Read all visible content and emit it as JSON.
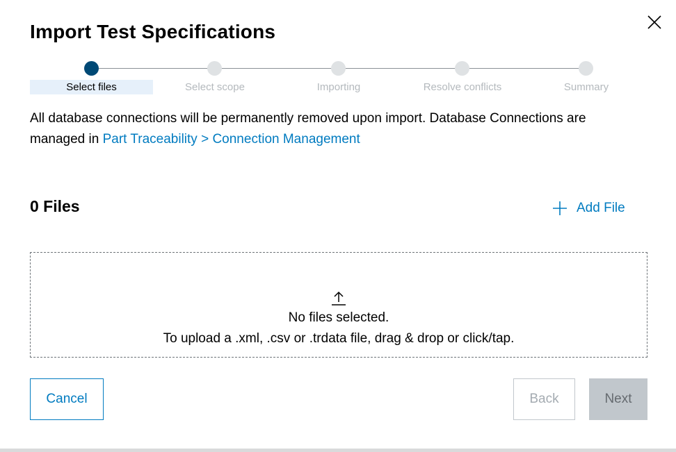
{
  "dialog": {
    "title": "Import Test Specifications",
    "close_icon": "close-icon"
  },
  "stepper": {
    "steps": [
      {
        "label": "Select files",
        "active": true
      },
      {
        "label": "Select scope",
        "active": false
      },
      {
        "label": "Importing",
        "active": false
      },
      {
        "label": "Resolve conflicts",
        "active": false
      },
      {
        "label": "Summary",
        "active": false
      }
    ]
  },
  "info": {
    "text": "All database connections will be permanently removed upon import. Database Connections are managed in",
    "link": "Part Traceability > Connection Management"
  },
  "files": {
    "count_label": "0 Files",
    "add_label": "Add File",
    "add_icon": "plus-icon"
  },
  "dropzone": {
    "icon": "upload-icon",
    "line1": "No files selected.",
    "line2": "To upload a .xml, .csv or .trdata file, drag & drop or click/tap."
  },
  "footer": {
    "cancel_label": "Cancel",
    "back_label": "Back",
    "next_label": "Next"
  },
  "colors": {
    "accent": "#007bc0",
    "active_step": "#004975",
    "inactive_step": "#dfe2e4",
    "active_label_bg": "#e6f0fa",
    "disabled_button": "#c1c7cc"
  }
}
